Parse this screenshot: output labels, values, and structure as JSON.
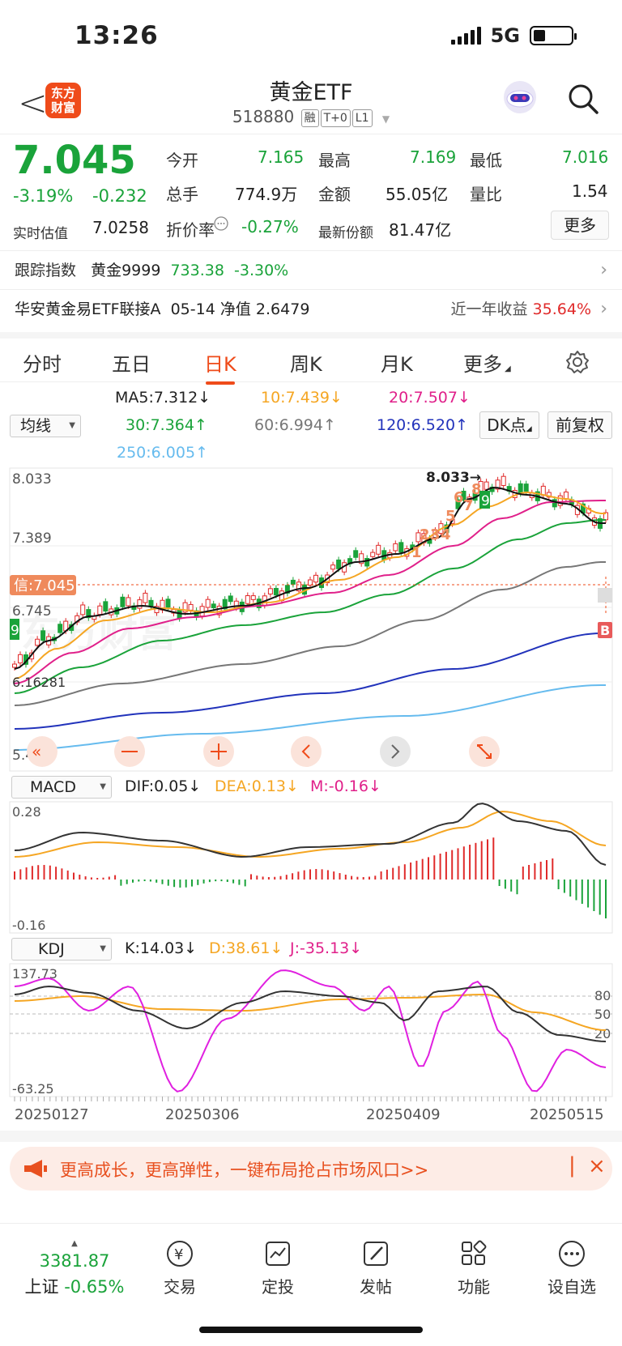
{
  "status_bar": {
    "time": "13:26",
    "network": "5G"
  },
  "header": {
    "back": "<",
    "logo_line1": "东方",
    "logo_line2": "财富",
    "title": "黄金ETF",
    "code": "518880",
    "tags": [
      "融",
      "T+0",
      "L1"
    ]
  },
  "quote": {
    "price": "7.045",
    "change_pct": "-3.19%",
    "change": "-0.232",
    "open_label": "今开",
    "open": "7.165",
    "high_label": "最高",
    "high": "7.169",
    "low_label": "最低",
    "low": "7.016",
    "volume_label": "总手",
    "volume": "774.9万",
    "amount_label": "金额",
    "amount": "55.05亿",
    "ratio_label": "量比",
    "ratio": "1.54",
    "iopv_label": "实时估值",
    "iopv": "7.0258",
    "discount_label": "折价率",
    "discount": "-0.27%",
    "shares_label": "最新份额",
    "shares": "81.47亿",
    "more": "更多"
  },
  "track": {
    "label": "跟踪指数",
    "name": "黄金9999",
    "value": "733.38",
    "pct": "-3.30%"
  },
  "linked": {
    "name": "华安黄金易ETF联接A",
    "date": "05-14",
    "nav_label": "净值",
    "nav": "2.6479",
    "ret_label": "近一年收益",
    "ret": "35.64%"
  },
  "tabs": [
    "分时",
    "五日",
    "日K",
    "周K",
    "月K",
    "更多"
  ],
  "ma": {
    "selector": "均线",
    "ma5": "MA5:7.312",
    "ma10": "10:7.439",
    "ma20": "20:7.507",
    "ma30": "30:7.364",
    "ma60": "60:6.994",
    "ma120": "120:6.520",
    "ma250": "250:6.005",
    "dk": "DK点",
    "adj": "前复权",
    "arrow_down": "↓",
    "arrow_up": "↑"
  },
  "kchart": {
    "y_top": "8.033",
    "y_mid": "7.389",
    "y_low": "6.745",
    "y_min_label": "6.16281",
    "y_bottom": "5.458",
    "peak_label": "8.033→",
    "current_label": "信:7.045",
    "b_mark": "B",
    "nine": "9",
    "seq": [
      "1",
      "2",
      "3",
      "4",
      "5",
      "6",
      "7",
      "8",
      "9"
    ]
  },
  "macd": {
    "selector": "MACD",
    "dif": "DIF:0.05",
    "dea": "DEA:0.13",
    "m": "M:-0.16",
    "top": "0.28",
    "bottom": "-0.16"
  },
  "kdj": {
    "selector": "KDJ",
    "k": "K:14.03",
    "d": "D:38.61",
    "j": "J:-35.13",
    "top": "137.73",
    "bottom": "-63.25",
    "l80": "80",
    "l50": "50",
    "l20": "20"
  },
  "dates": [
    "20250127",
    "20250306",
    "20250409",
    "20250515"
  ],
  "banner": {
    "text": "更高成长，更高弹性，一键布局抢占市场风口>>"
  },
  "bottom": {
    "index_value": "3381.87",
    "index_name": "上证",
    "index_pct": "-0.65%",
    "items": [
      "交易",
      "定投",
      "发帖",
      "功能",
      "设自选"
    ]
  },
  "colors": {
    "red": "#e02a2a",
    "green": "#1aa33a",
    "orange": "#ef4b1a",
    "ma10": "#f5a623",
    "ma20": "#e0208a",
    "ma30": "#1aa33a",
    "ma60": "#777777",
    "ma120": "#2233bb",
    "ma250": "#66bbee"
  }
}
